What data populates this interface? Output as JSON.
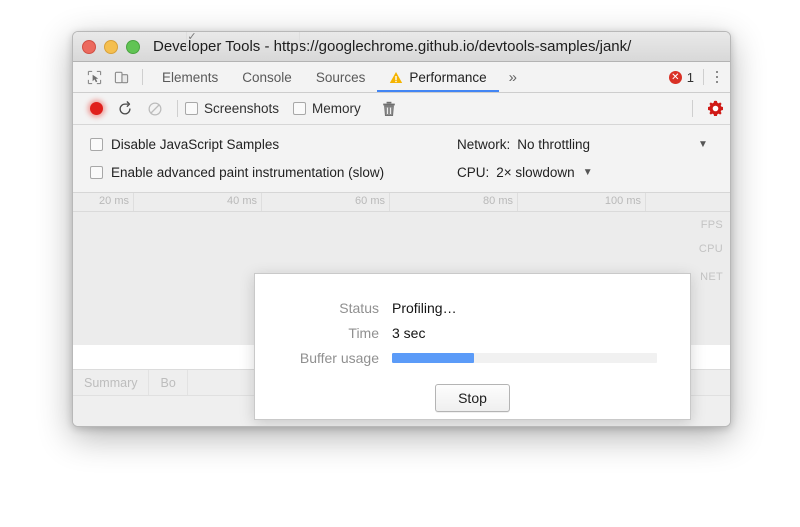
{
  "window": {
    "title": "Developer Tools - https://googlechrome.github.io/devtools-samples/jank/",
    "traffic_lights": [
      "close",
      "minimize",
      "maximize"
    ]
  },
  "tab_bar": {
    "inspect_icon": "inspect-cursor-icon",
    "device_icon": "device-toolbar-icon",
    "tabs": [
      {
        "label": "Elements",
        "selected": false,
        "warning": false
      },
      {
        "label": "Console",
        "selected": false,
        "warning": false
      },
      {
        "label": "Sources",
        "selected": false,
        "warning": false
      },
      {
        "label": "Performance",
        "selected": true,
        "warning": true
      }
    ],
    "more_tabs": "»",
    "error_badge": {
      "icon": "error-circle-icon",
      "symbol": "✕",
      "count": "1"
    },
    "overflow_menu": "vertical-dots-icon"
  },
  "controls": {
    "record_button": "record-icon",
    "reload_button": "reload-icon",
    "clear_button": "clear-icon",
    "screenshots": {
      "label": "Screenshots",
      "checked": true,
      "tick": "✓"
    },
    "memory": {
      "label": "Memory",
      "checked": false,
      "tick": ""
    },
    "trash_button": "trash-icon",
    "settings_button": "settings-gear-icon"
  },
  "options": {
    "disable_js_samples": {
      "label": "Disable JavaScript Samples",
      "checked": false
    },
    "advanced_paint": {
      "label": "Enable advanced paint instrumentation (slow)",
      "checked": false
    },
    "network": {
      "label": "Network:",
      "value": "No throttling",
      "caret": "▼"
    },
    "cpu": {
      "label": "CPU:",
      "value": "2× slowdown",
      "caret": "▼"
    }
  },
  "overview": {
    "ruler_ticks": [
      "20 ms",
      "40 ms",
      "60 ms",
      "80 ms",
      "100 ms"
    ],
    "lanes": [
      "FPS",
      "CPU",
      "NET"
    ]
  },
  "bottom_tabs": [
    {
      "label": "Summary"
    },
    {
      "label": "Bo"
    }
  ],
  "dialog": {
    "status": {
      "label": "Status",
      "value": "Profiling…"
    },
    "time": {
      "label": "Time",
      "value": "3 sec"
    },
    "buffer": {
      "label": "Buffer usage",
      "percent": 31
    },
    "stop_label": "Stop"
  },
  "colors": {
    "accent_blue": "#4285f4",
    "progress_blue": "#5b9bf8",
    "record_red": "#e0201c",
    "error_red": "#d93025",
    "warning_amber": "#f5b400",
    "tl_close": "#ec6a5e",
    "tl_min": "#f5bf4f",
    "tl_max": "#61c454"
  }
}
